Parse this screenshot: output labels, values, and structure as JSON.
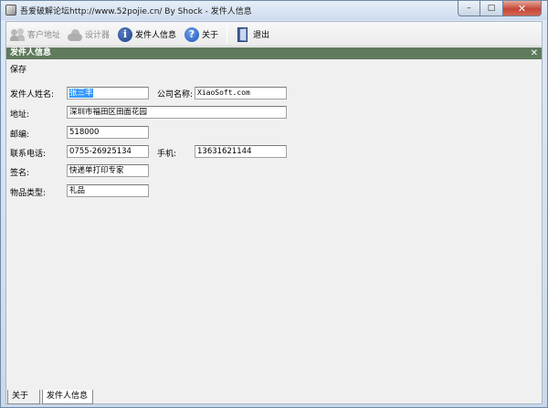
{
  "window": {
    "title": "吾爱破解论坛http://www.52pojie.cn/ By Shock - 发件人信息",
    "minimize_glyph": "–",
    "maximize_glyph": "□",
    "close_glyph": "✕"
  },
  "toolbar": {
    "items": [
      {
        "label": "客户地址",
        "icon": "users-icon",
        "enabled": false
      },
      {
        "label": "设计器",
        "icon": "cloud-icon",
        "enabled": false
      },
      {
        "label": "发件人信息",
        "icon": "info-icon",
        "enabled": true
      },
      {
        "label": "关于",
        "icon": "help-icon",
        "enabled": true
      },
      {
        "label": "退出",
        "icon": "exit-door-icon",
        "enabled": true
      }
    ],
    "info_glyph": "i",
    "help_glyph": "?"
  },
  "panel": {
    "title": "发件人信息",
    "close_glyph": "✕",
    "menu_save": "保存"
  },
  "form": {
    "sender_name_label": "发件人姓名:",
    "sender_name_value": "张三丰",
    "company_label": "公司名称:",
    "company_value": "XiaoSoft.com",
    "address_label": "地址:",
    "address_value": "深圳市福田区田面花园",
    "postcode_label": "邮编:",
    "postcode_value": "518000",
    "phone_label": "联系电话:",
    "phone_value": "0755-26925134",
    "mobile_label": "手机:",
    "mobile_value": "13631621144",
    "signature_label": "签名:",
    "signature_value": "快递单打印专家",
    "item_type_label": "物品类型:",
    "item_type_value": "礼品"
  },
  "tabs": [
    {
      "label": "关于",
      "active": false
    },
    {
      "label": "发件人信息",
      "active": true
    }
  ]
}
